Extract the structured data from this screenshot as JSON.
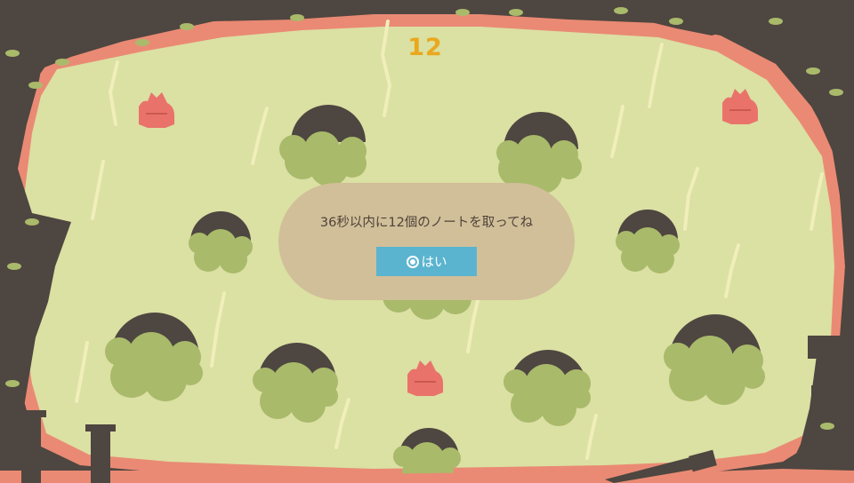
{
  "hud": {
    "notes_remaining": "12"
  },
  "dialog": {
    "message": "36秒以内に12個のノートを取ってね",
    "confirm_label": "はい",
    "confirm_icon": "circle-button-icon"
  },
  "colors": {
    "arena_floor": "#dbe0a3",
    "arena_rim": "#ea8a74",
    "rock": "#4e4640",
    "bush": "#a9ba6b",
    "note_creature": "#e9736b",
    "counter_text": "#e9a81d",
    "dialog_bg": "#d1bf99",
    "button_bg": "#5ab4cf"
  }
}
